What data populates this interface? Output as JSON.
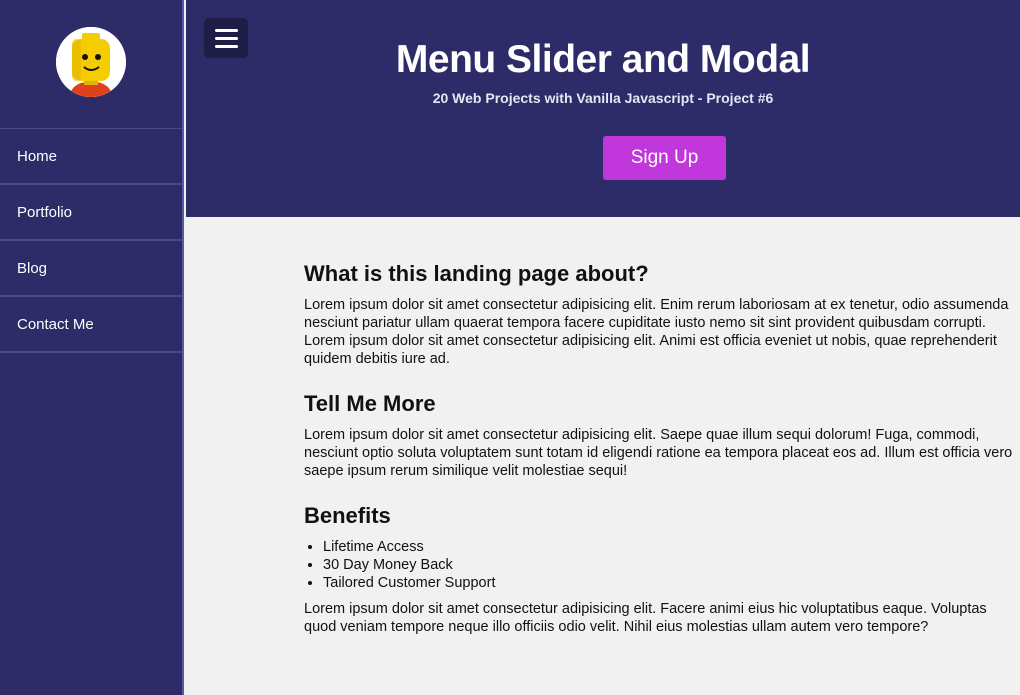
{
  "sidebar": {
    "avatar_icon": "lego-head-avatar",
    "items": [
      {
        "label": "Home"
      },
      {
        "label": "Portfolio"
      },
      {
        "label": "Blog"
      },
      {
        "label": "Contact Me"
      }
    ]
  },
  "header": {
    "menu_icon": "hamburger-menu-icon",
    "title": "Menu Slider and Modal",
    "subtitle": "20 Web Projects with Vanilla Javascript - Project #6",
    "signup_label": "Sign Up"
  },
  "main": {
    "sections": [
      {
        "heading": "What is this landing page about?",
        "lines": [
          "Lorem ipsum dolor sit amet consectetur adipisicing elit. Enim rerum laboriosam at ex tenetur, odio assumenda",
          "nesciunt pariatur ullam quaerat tempora facere cupiditate iusto nemo sit sint provident quibusdam corrupti.",
          "Lorem ipsum dolor sit amet consectetur adipisicing elit. Animi est officia eveniet ut nobis, quae reprehenderit",
          "quidem debitis iure ad."
        ]
      },
      {
        "heading": "Tell Me More",
        "lines": [
          "Lorem ipsum dolor sit amet consectetur adipisicing elit. Saepe quae illum sequi dolorum! Fuga, commodi,",
          "nesciunt optio soluta voluptatem sunt totam id eligendi ratione ea tempora placeat eos ad. Illum est officia vero",
          "saepe ipsum rerum similique velit molestiae sequi!"
        ]
      },
      {
        "heading": "Benefits",
        "list": [
          "Lifetime Access",
          "30 Day Money Back",
          "Tailored Customer Support"
        ],
        "lines": [
          "Lorem ipsum dolor sit amet consectetur adipisicing elit. Facere animi eius hic voluptatibus eaque. Voluptas",
          "quod veniam tempore neque illo officiis odio velit. Nihil eius molestias ullam autem vero tempore?"
        ]
      }
    ]
  },
  "colors": {
    "primary": "#2e2c68",
    "accent": "#c037db",
    "background": "#f1f1f1"
  }
}
